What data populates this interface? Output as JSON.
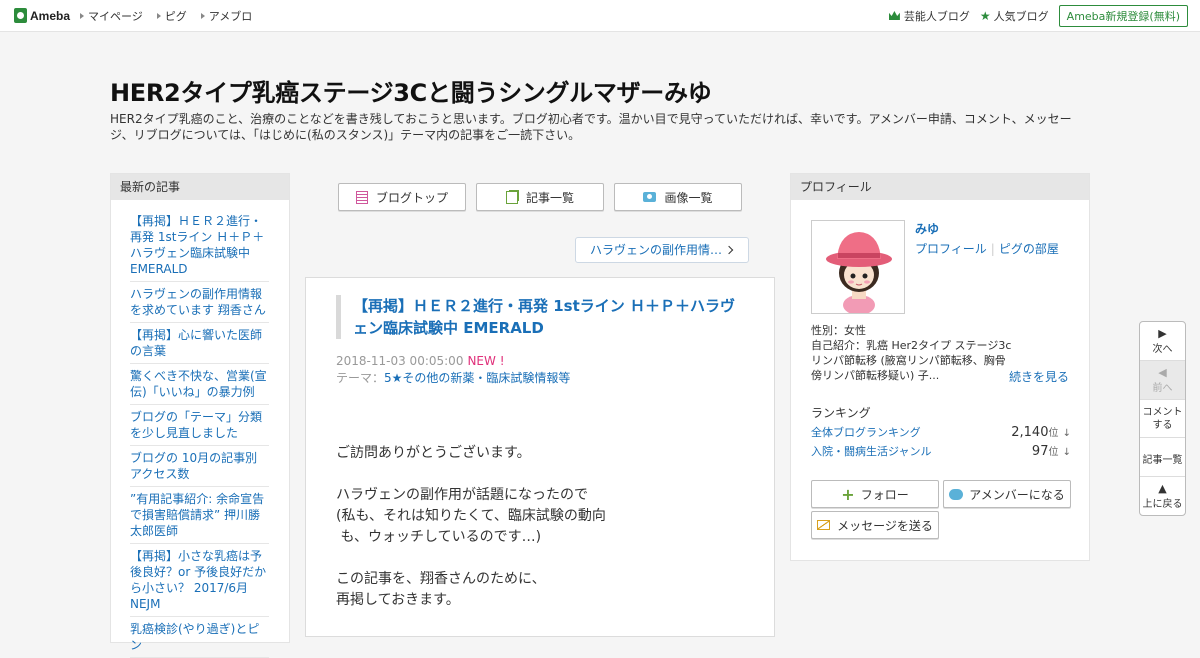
{
  "topbar": {
    "logo": "Ameba",
    "nav": [
      "マイページ",
      "ピグ",
      "アメブロ"
    ],
    "right": {
      "celebrity": "芸能人ブログ",
      "popular": "人気ブログ",
      "signup": "Ameba新規登録(無料)"
    }
  },
  "header": {
    "title": "HER2タイプ乳癌ステージ3Cと闘うシングルマザーみゆ",
    "description": "HER2タイプ乳癌のこと、治療のことなどを書き残しておこうと思います。ブログ初心者です。温かい目で見守っていただければ、幸いです。アメンバー申請、コメント、メッセージ、リブログについては、「はじめに(私のスタンス)」テーマ内の記事をご一読下さい。"
  },
  "sidebar_left": {
    "heading": "最新の記事",
    "items": [
      "【再掲】ＨＥＲ２進行・再発 1stライン Ｈ＋Ｐ＋ハラヴェン臨床試験中 EMERALD",
      "ハラヴェンの副作用情報を求めています 翔香さん",
      "【再掲】心に響いた医師の言葉",
      "驚くべき不快な、営業(宣伝)「いいね」の暴力例",
      "ブログの「テーマ」分類を少し見直しました",
      "ブログの 10月の記事別 アクセス数",
      "”有用記事紹介: 余命宣告で損害賠償請求” 押川勝太郎医師",
      "【再掲】小さな乳癌は予後良好？or 予後良好だから小さい？ 2017/6月 NEJM",
      "乳癌検診(やり過ぎ)とピン"
    ]
  },
  "center": {
    "nav_buttons": {
      "top": "ブログトップ",
      "list": "記事一覧",
      "images": "画像一覧"
    },
    "prev_link": "ハラヴェンの副作用情…",
    "article": {
      "title": "【再掲】ＨＥＲ２進行・再発 1stライン Ｈ＋Ｐ＋ハラヴェン臨床試験中 EMERALD",
      "date": "2018-11-03 00:05:00",
      "new_badge": "NEW !",
      "theme_label": "テーマ：",
      "theme": "5★その他の新薬・臨床試験情報等",
      "body": [
        "ご訪問ありがとうございます。",
        "ハラヴェンの副作用が話題になったので",
        "(私も、それは知りたくて、臨床試験の動向",
        " も、ウォッチしているのです…)",
        "この記事を、翔香さんのために、",
        "再掲しておきます。"
      ]
    }
  },
  "profile": {
    "heading": "プロフィール",
    "name": "みゆ",
    "link_profile": "プロフィール",
    "link_pig": "ピグの部屋",
    "gender": "性別：女性",
    "intro": "自己紹介：乳癌 Her2タイプ ステージ3c リンパ節転移 (腋窩リンパ節転移、胸骨傍リンパ節転移疑い) 子...",
    "more": "続きを見る",
    "ranking_heading": "ランキング",
    "ranking": [
      {
        "label": "全体ブログランキング",
        "value": "2,140",
        "unit": "位",
        "trend": "↓"
      },
      {
        "label": "入院・闘病生活ジャンル",
        "value": "97",
        "unit": "位",
        "trend": "↓"
      }
    ],
    "follow": "フォロー",
    "amember": "アメンバーになる",
    "message": "メッセージを送る"
  },
  "float_nav": {
    "next": "次へ",
    "prev": "前へ",
    "comment": "コメントする",
    "list": "記事一覧",
    "top": "上に戻る"
  },
  "colors": {
    "link": "#1a6fb7",
    "brand": "#2d8c3c",
    "new": "#e0307a"
  }
}
